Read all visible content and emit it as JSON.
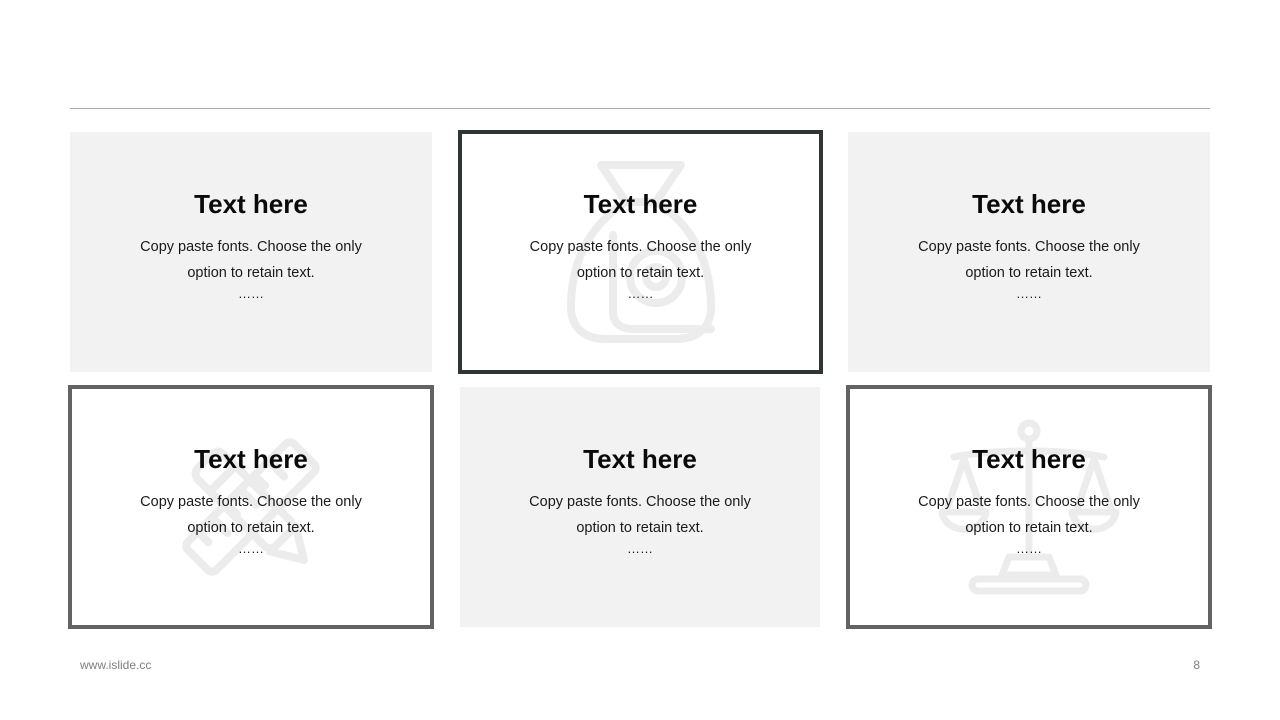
{
  "cards": [
    {
      "title": "Text here",
      "body": "Copy paste fonts. Choose the only option to retain text.",
      "ellipsis": "……",
      "icon": "none"
    },
    {
      "title": "Text here",
      "body": "Copy paste fonts. Choose the only option to retain text.",
      "ellipsis": "……",
      "icon": "money-bag-icon"
    },
    {
      "title": "Text here",
      "body": "Copy paste fonts. Choose the only option to retain text.",
      "ellipsis": "……",
      "icon": "none"
    },
    {
      "title": "Text here",
      "body": "Copy paste fonts. Choose the only option to retain text.",
      "ellipsis": "……",
      "icon": "ruler-pencil-icon"
    },
    {
      "title": "Text here",
      "body": "Copy paste fonts. Choose the only option to retain text.",
      "ellipsis": "……",
      "icon": "none"
    },
    {
      "title": "Text here",
      "body": "Copy paste fonts. Choose the only option to retain text.",
      "ellipsis": "……",
      "icon": "scales-icon"
    }
  ],
  "footer": {
    "url": "www.islide.cc",
    "page_number": "8"
  },
  "colors": {
    "card_fill": "#f2f2f2",
    "border_dark": "#2f3435",
    "border_gray": "#636363",
    "watermark": "#ececec",
    "rule": "#a9a9a9",
    "footer_text": "#7f7f7f"
  }
}
